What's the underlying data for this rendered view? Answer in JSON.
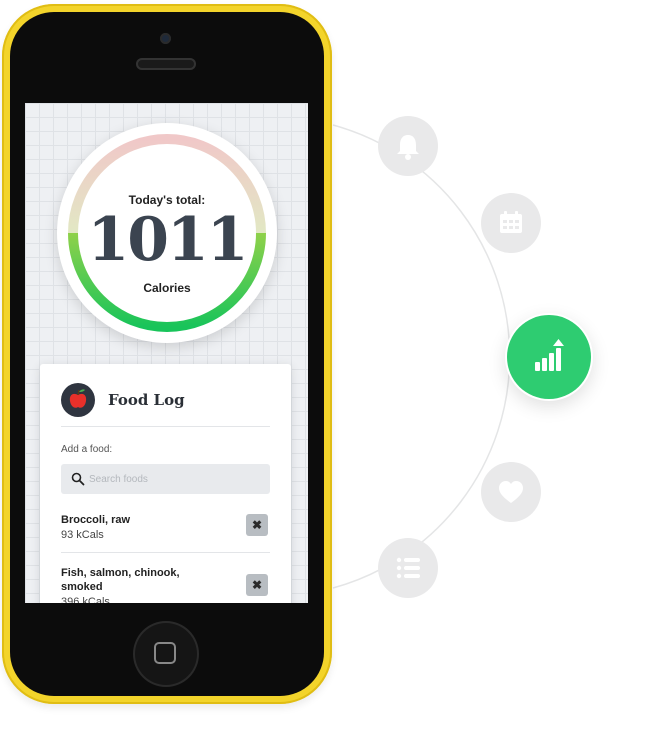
{
  "gauge": {
    "label": "Today's total:",
    "value": "1011",
    "unit": "Calories",
    "fraction": 0.5
  },
  "food_log": {
    "title": "Food Log",
    "icon": "apple-icon",
    "add_label": "Add a food:",
    "search_placeholder": "Search foods",
    "items": [
      {
        "name": "Broccoli, raw",
        "kcal": "93 kCals",
        "remove": "✖"
      },
      {
        "name": "Fish, salmon, chinook, smoked",
        "kcal": "396 kCals",
        "remove": "✖"
      }
    ]
  },
  "feature_menu": {
    "items": [
      {
        "icon": "bell-icon",
        "active": false
      },
      {
        "icon": "calendar-icon",
        "active": false
      },
      {
        "icon": "chart-icon",
        "active": true
      },
      {
        "icon": "heart-icon",
        "active": false
      },
      {
        "icon": "list-icon",
        "active": false
      }
    ]
  },
  "colors": {
    "phone_shell": "#f3d42b",
    "accent_green": "#2ecc71",
    "feature_inactive": "#e9e9ea",
    "text_dark": "#3b4450"
  }
}
